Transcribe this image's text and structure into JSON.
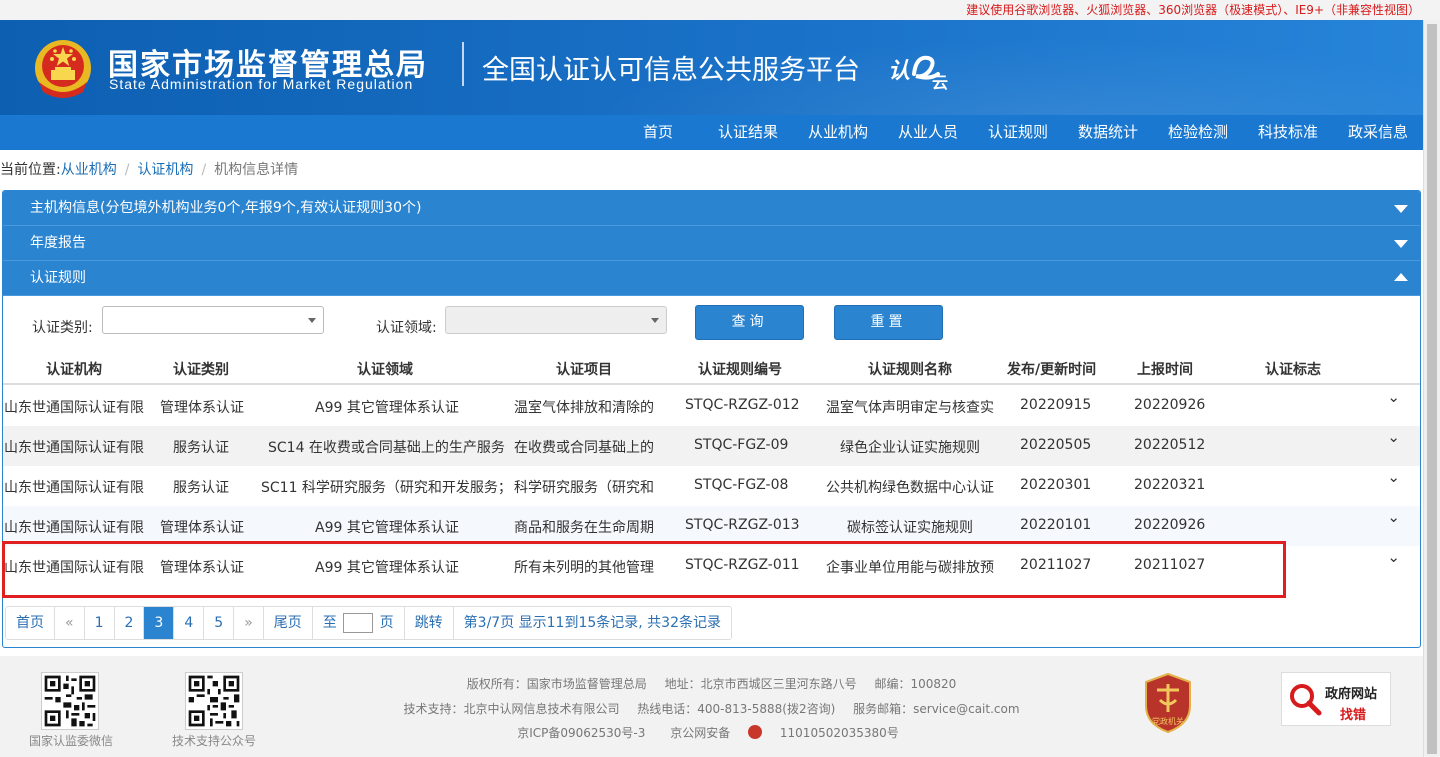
{
  "notice": "建议使用谷歌浏览器、火狐浏览器、360浏览器（极速模式）、IE9+（非兼容性视图）",
  "header": {
    "org_cn": "国家市场监督管理总局",
    "org_en": "State Administration  for  Market Regulation",
    "platform": "全国认证认可信息公共服务平台",
    "logo_text": "认e云"
  },
  "nav": [
    "首页",
    "认证结果",
    "从业机构",
    "从业人员",
    "认证规则",
    "数据统计",
    "检验检测",
    "科技标准",
    "政采信息"
  ],
  "breadcrumb": {
    "prefix": "当前位置:",
    "items": [
      "从业机构",
      "认证机构",
      "机构信息详情"
    ]
  },
  "sections": [
    {
      "title": "主机构信息(分包境外机构业务0个,年报9个,有效认证规则30个)",
      "state": "collapsed"
    },
    {
      "title": "年度报告",
      "state": "collapsed"
    },
    {
      "title": "认证规则",
      "state": "expanded"
    }
  ],
  "filters": {
    "category_label": "认证类别:",
    "category_value": "",
    "field_label": "认证领域:",
    "field_value": "",
    "query_button": "查询",
    "reset_button": "重置"
  },
  "table": {
    "columns": [
      "认证机构",
      "认证类别",
      "认证领域",
      "认证项目",
      "认证规则编号",
      "认证规则名称",
      "发布/更新时间",
      "上报时间",
      "认证标志"
    ],
    "rows": [
      [
        "山东世通国际认证有限",
        "管理体系认证",
        "A99 其它管理体系认证",
        "温室气体排放和清除的",
        "STQC-RZGZ-012",
        "温室气体声明审定与核查实",
        "20220915",
        "20220926",
        ""
      ],
      [
        "山东世通国际认证有限",
        "服务认证",
        "SC14 在收费或合同基础上的生产服务",
        "在收费或合同基础上的",
        "STQC-FGZ-09",
        "绿色企业认证实施规则",
        "20220505",
        "20220512",
        ""
      ],
      [
        "山东世通国际认证有限",
        "服务认证",
        "SC11 科学研究服务（研究和开发服务；",
        "科学研究服务（研究和",
        "STQC-FGZ-08",
        "公共机构绿色数据中心认证",
        "20220301",
        "20220321",
        ""
      ],
      [
        "山东世通国际认证有限",
        "管理体系认证",
        "A99 其它管理体系认证",
        "商品和服务在生命周期",
        "STQC-RZGZ-013",
        "碳标签认证实施规则",
        "20220101",
        "20220926",
        ""
      ],
      [
        "山东世通国际认证有限",
        "管理体系认证",
        "A99 其它管理体系认证",
        "所有未列明的其他管理",
        "STQC-RZGZ-011",
        "企事业单位用能与碳排放预",
        "20211027",
        "20211027",
        ""
      ]
    ]
  },
  "pagination": {
    "first": "首页",
    "prev": "«",
    "pages": [
      "1",
      "2",
      "3",
      "4",
      "5"
    ],
    "current": "3",
    "next": "»",
    "last": "尾页",
    "goto_prefix": "至",
    "goto_suffix": "页",
    "jump": "跳转",
    "summary": "第3/7页  显示11到15条记录, 共32条记录"
  },
  "footer": {
    "qr1_caption": "国家认监委微信",
    "qr2_caption": "技术支持公众号",
    "copyright": "版权所有：国家市场监督管理总局",
    "address": "地址：北京市西城区三里河东路八号",
    "postcode": "邮编：100820",
    "tech": "技术支持：北京中认网信息技术有限公司",
    "hotline": "热线电话：400-813-5888(拨2咨询)",
    "email": "服务邮箱：service@cait.com",
    "icp": "京ICP备09062530号-3",
    "police": "京公网安备",
    "police_no": "11010502035380号",
    "badge_text": "党政机关",
    "gov_site_1": "政府网站",
    "gov_site_2": "找错"
  },
  "colors": {
    "header_blue": "#1565c0",
    "nav_blue": "#1a78d0",
    "panel_blue": "#2b84d0",
    "highlight_red": "#e02020",
    "notice_red": "#d71a1b"
  }
}
